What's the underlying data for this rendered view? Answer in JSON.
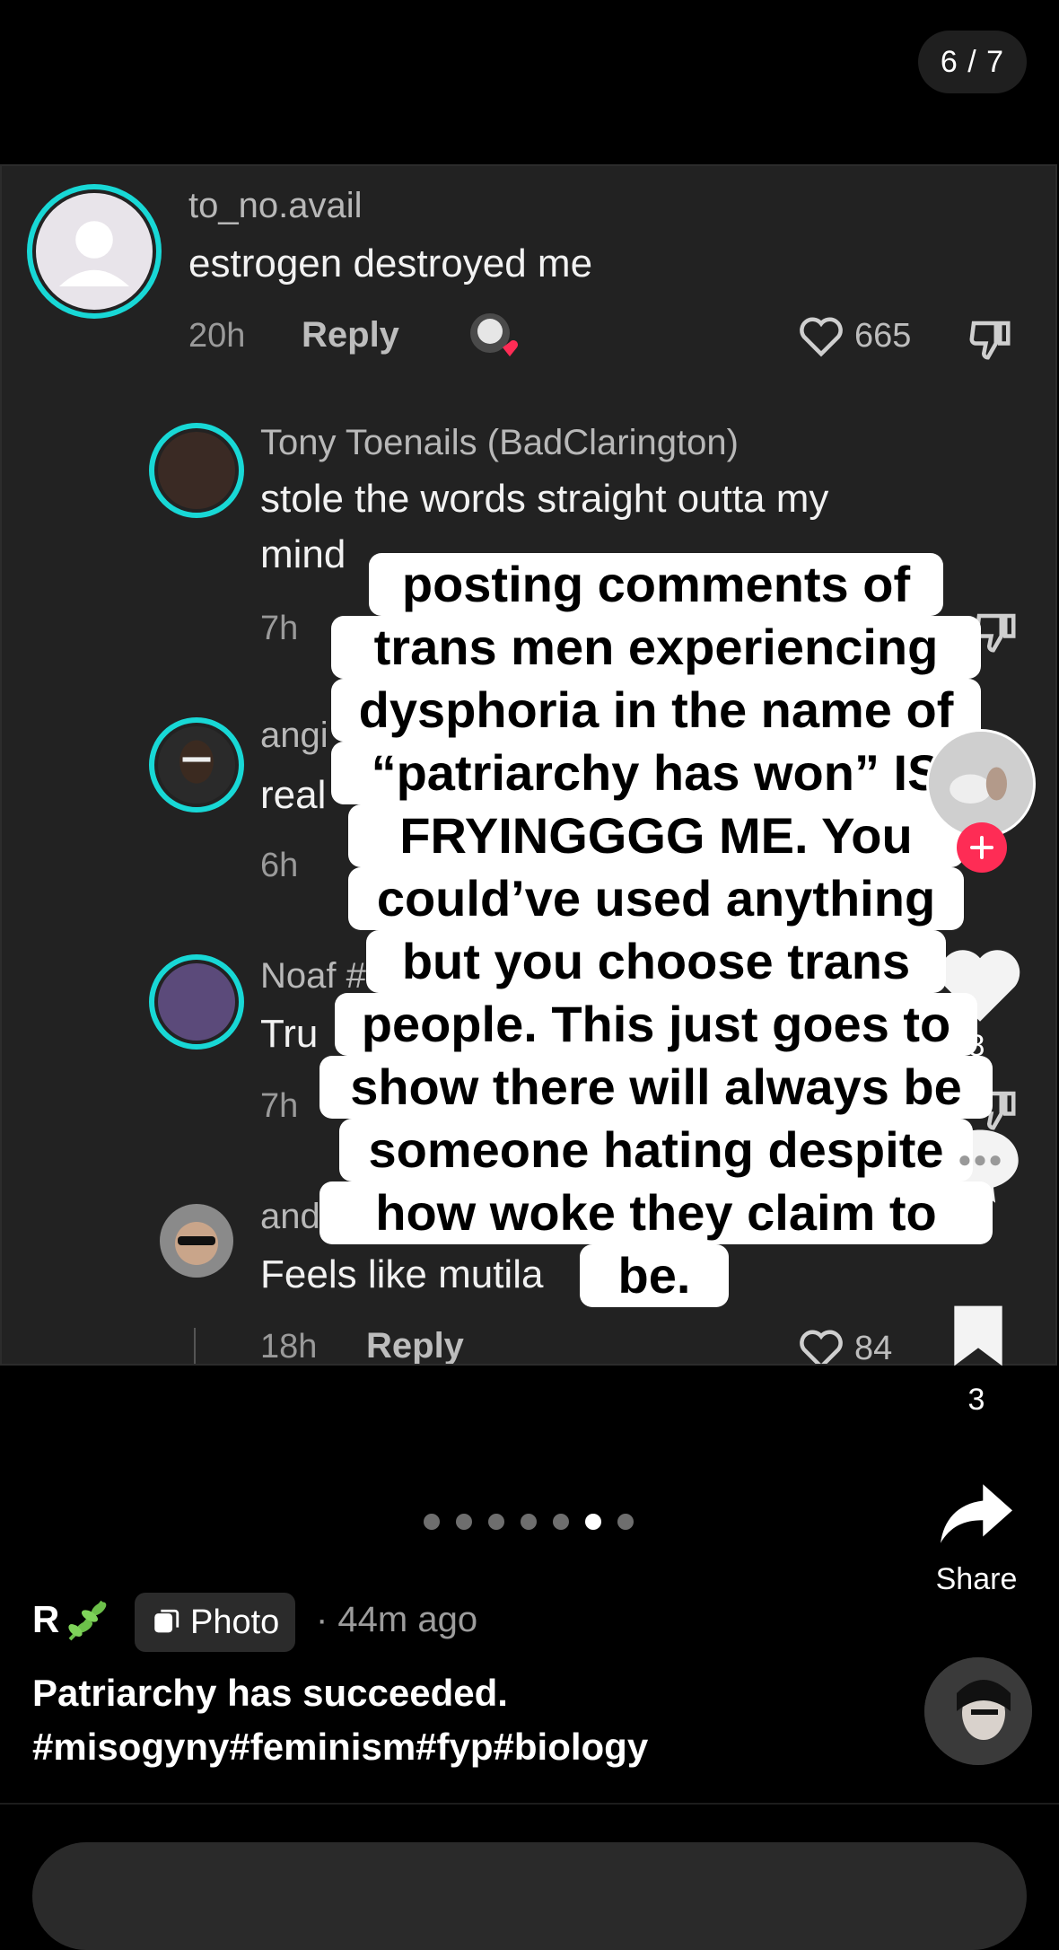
{
  "counter": "6 / 7",
  "comments": [
    {
      "user": "to_no.avail",
      "text": "estrogen destroyed me",
      "time": "20h",
      "reply": "Reply",
      "likes": "665"
    },
    {
      "user": "Tony Toenails (BadClarington)",
      "text_line1": "stole the words straight outta my",
      "text_line2": "mind",
      "time": "7h"
    },
    {
      "user": "angi",
      "text": "real",
      "time": "6h"
    },
    {
      "user": "Noaf #",
      "text": "Tru",
      "time": "7h"
    },
    {
      "user": "and",
      "text": "Feels like mutila",
      "time": "18h",
      "reply": "Reply",
      "likes": "84"
    }
  ],
  "overlay_caption": [
    "posting comments of",
    "trans men experiencing",
    "dysphoria in the name of",
    "“patriarchy has won” IS",
    "FRYINGGGG ME. You",
    "could’ve used anything",
    "but you choose trans",
    "people. This just goes to",
    "show there will always be",
    "someone hating despite",
    "how woke they claim to",
    "be."
  ],
  "rail": {
    "like_count": "8",
    "bookmark_count": "3",
    "share_label": "Share"
  },
  "dots": {
    "count": 7,
    "active_index": 5
  },
  "footer": {
    "author": "R",
    "type_chip": "Photo",
    "time_ago": "· 44m ago",
    "title": "Patriarchy has succeeded.",
    "hashtags": "#misogyny#feminism#fyp#biology"
  },
  "colors": {
    "accent_cyan": "#18d8d6",
    "follow_red": "#fe2c55",
    "background": "#000000",
    "screenshot_bg": "#222222"
  }
}
